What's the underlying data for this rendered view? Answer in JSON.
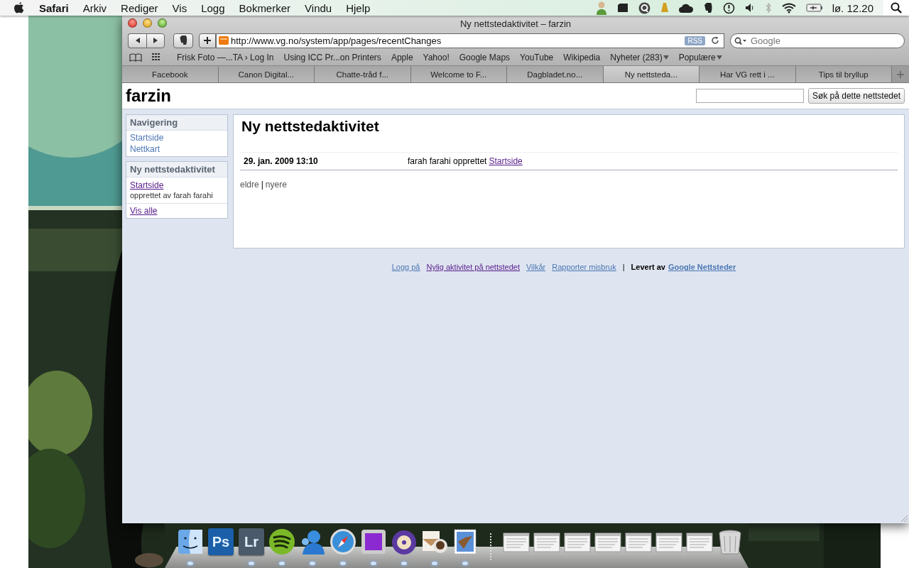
{
  "menubar": {
    "app": "Safari",
    "menus": [
      "Arkiv",
      "Rediger",
      "Vis",
      "Logg",
      "Bokmerker",
      "Vindu",
      "Hjelp"
    ],
    "clock": "lø. 12.20"
  },
  "window": {
    "title": "Ny nettstedaktivitet – farzin",
    "url": "http://www.vg.no/system/app/pages/recentChanges",
    "rss": "RSS",
    "search_placeholder": "Google",
    "bookmarks": [
      {
        "label": "Frisk Foto —...TA › Log In",
        "has_menu": false
      },
      {
        "label": "Using ICC Pr...on Printers",
        "has_menu": false
      },
      {
        "label": "Apple",
        "has_menu": false
      },
      {
        "label": "Yahoo!",
        "has_menu": false
      },
      {
        "label": "Google Maps",
        "has_menu": false
      },
      {
        "label": "YouTube",
        "has_menu": false
      },
      {
        "label": "Wikipedia",
        "has_menu": false
      },
      {
        "label": "Nyheter (283)",
        "has_menu": true
      },
      {
        "label": "Populære",
        "has_menu": true
      }
    ],
    "tabs": [
      {
        "label": "Facebook",
        "selected": false
      },
      {
        "label": "Canon Digital...",
        "selected": false
      },
      {
        "label": "Chatte-tråd f...",
        "selected": false
      },
      {
        "label": "Welcome to F...",
        "selected": false
      },
      {
        "label": "Dagbladet.no...",
        "selected": false
      },
      {
        "label": "Ny nettsteda...",
        "selected": true
      },
      {
        "label": "Har VG rett i ...",
        "selected": false
      },
      {
        "label": "Tips til bryllup",
        "selected": false
      }
    ]
  },
  "site": {
    "name": "farzin",
    "search_button": "Søk på dette nettstedet",
    "sidebar": [
      {
        "title": "Navigering",
        "items": [
          {
            "kind": "link",
            "text": "Startside",
            "visited": false
          },
          {
            "kind": "link",
            "text": "Nettkart",
            "visited": false
          }
        ]
      },
      {
        "title": "Ny nettstedaktivitet",
        "items": [
          {
            "kind": "entry",
            "text": "Startside",
            "visited": true,
            "note": "opprettet av farah farahi"
          },
          {
            "kind": "more",
            "text": "Vis alle",
            "visited": true
          }
        ]
      }
    ],
    "heading": "Ny nettstedaktivitet",
    "activity": [
      {
        "date": "29. jan. 2009 13:10",
        "text": "farah farahi opprettet",
        "link": "Startside"
      }
    ],
    "pager": {
      "older": "eldre",
      "separator": "|",
      "newer": "nyere"
    },
    "footer": [
      {
        "kind": "link",
        "text": "Logg på",
        "visited": false
      },
      {
        "kind": "link",
        "text": "Nylig aktivitet på nettstedet",
        "visited": true
      },
      {
        "kind": "link",
        "text": "Vilkår",
        "visited": false
      },
      {
        "kind": "link",
        "text": "Rapporter misbruk",
        "visited": false
      },
      {
        "kind": "separator",
        "text": "|"
      },
      {
        "kind": "label",
        "text": "Levert av"
      },
      {
        "kind": "brand",
        "text": "Google Nettsteder",
        "visited": false
      }
    ]
  },
  "dock": [
    {
      "kind": "finder",
      "running": true
    },
    {
      "kind": "tile",
      "label": "Ps",
      "color": "#1b5fa8",
      "running": false
    },
    {
      "kind": "tile",
      "label": "Lr",
      "color": "#4a5a6a",
      "running": true
    },
    {
      "kind": "spotify",
      "running": true
    },
    {
      "kind": "person",
      "running": true
    },
    {
      "kind": "compass",
      "running": true
    },
    {
      "kind": "square",
      "running": true
    },
    {
      "kind": "disc",
      "running": true
    },
    {
      "kind": "letter",
      "running": true
    },
    {
      "kind": "stamp",
      "running": true
    },
    {
      "kind": "separator"
    },
    {
      "kind": "window",
      "running": false
    },
    {
      "kind": "window",
      "running": false
    },
    {
      "kind": "window",
      "running": false
    },
    {
      "kind": "window",
      "running": false
    },
    {
      "kind": "window",
      "running": false
    },
    {
      "kind": "window",
      "running": false
    },
    {
      "kind": "window",
      "running": false
    },
    {
      "kind": "trash",
      "running": false
    }
  ]
}
